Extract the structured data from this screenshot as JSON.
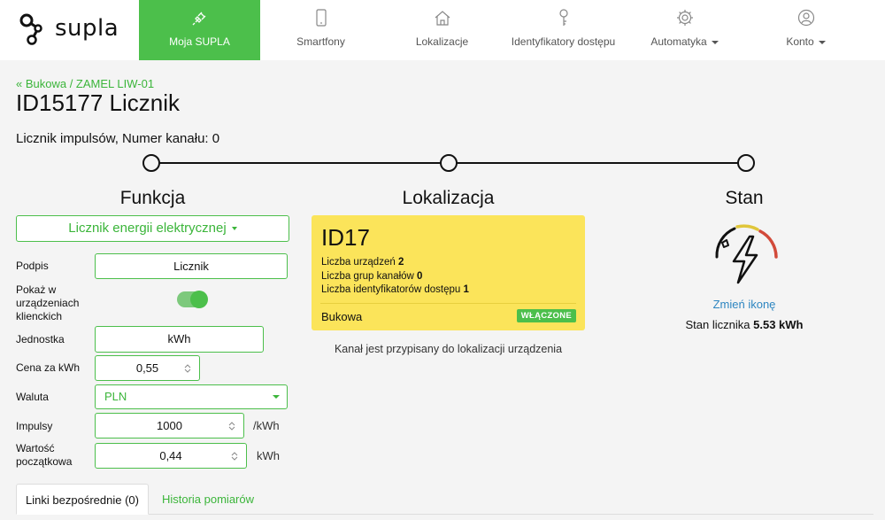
{
  "brand": {
    "name": "supla"
  },
  "nav": [
    {
      "label": "Moja SUPLA",
      "icon": "plug-icon",
      "active": true
    },
    {
      "label": "Smartfony",
      "icon": "smartphone-icon"
    },
    {
      "label": "Lokalizacje",
      "icon": "home-icon"
    },
    {
      "label": "Identyfikatory dostępu",
      "icon": "key-icon"
    },
    {
      "label": "Automatyka",
      "icon": "gear-icon",
      "dropdown": true
    },
    {
      "label": "Konto",
      "icon": "user-icon",
      "dropdown": true
    }
  ],
  "breadcrumb": "« Bukowa / ZAMEL LIW-01",
  "page_title": "ID15177 Licznik",
  "subtitle": "Licznik impulsów, Numer kanału: 0",
  "columns": {
    "function": "Funkcja",
    "location": "Lokalizacja",
    "state": "Stan"
  },
  "function_select": {
    "value": "Licznik energii elektrycznej"
  },
  "form": {
    "caption": {
      "label": "Podpis",
      "value": "Licznik"
    },
    "show_in_clients": {
      "label": "Pokaż w urządzeniach klienckich",
      "on": true
    },
    "unit": {
      "label": "Jednostka",
      "value": "kWh"
    },
    "price": {
      "label": "Cena za kWh",
      "value": "0,55"
    },
    "currency": {
      "label": "Waluta",
      "value": "PLN"
    },
    "impulses": {
      "label": "Impulsy",
      "value": "1000",
      "unit": "/kWh"
    },
    "initial": {
      "label": "Wartość początkowa",
      "value": "0,44",
      "unit": "kWh"
    }
  },
  "location_card": {
    "id": "ID17",
    "devices_label": "Liczba urządzeń",
    "devices": "2",
    "groups_label": "Liczba grup kanałów",
    "groups": "0",
    "ids_label": "Liczba identyfikatorów dostępu",
    "ids": "1",
    "name": "Bukowa",
    "badge": "WŁĄCZONE",
    "color": "#fbe45a"
  },
  "location_note": "Kanał jest przypisany do lokalizacji urządzenia",
  "state": {
    "icon": "electricity-meter-icon",
    "change_icon": "Zmień ikonę",
    "meter_label": "Stan licznika",
    "meter_value": "5.53 kWh"
  },
  "tabs": [
    {
      "label": "Linki bezpośrednie (0)",
      "active": true
    },
    {
      "label": "Historia pomiarów"
    }
  ],
  "colors": {
    "accent": "#4cbf4b",
    "link": "#2e86c1"
  }
}
